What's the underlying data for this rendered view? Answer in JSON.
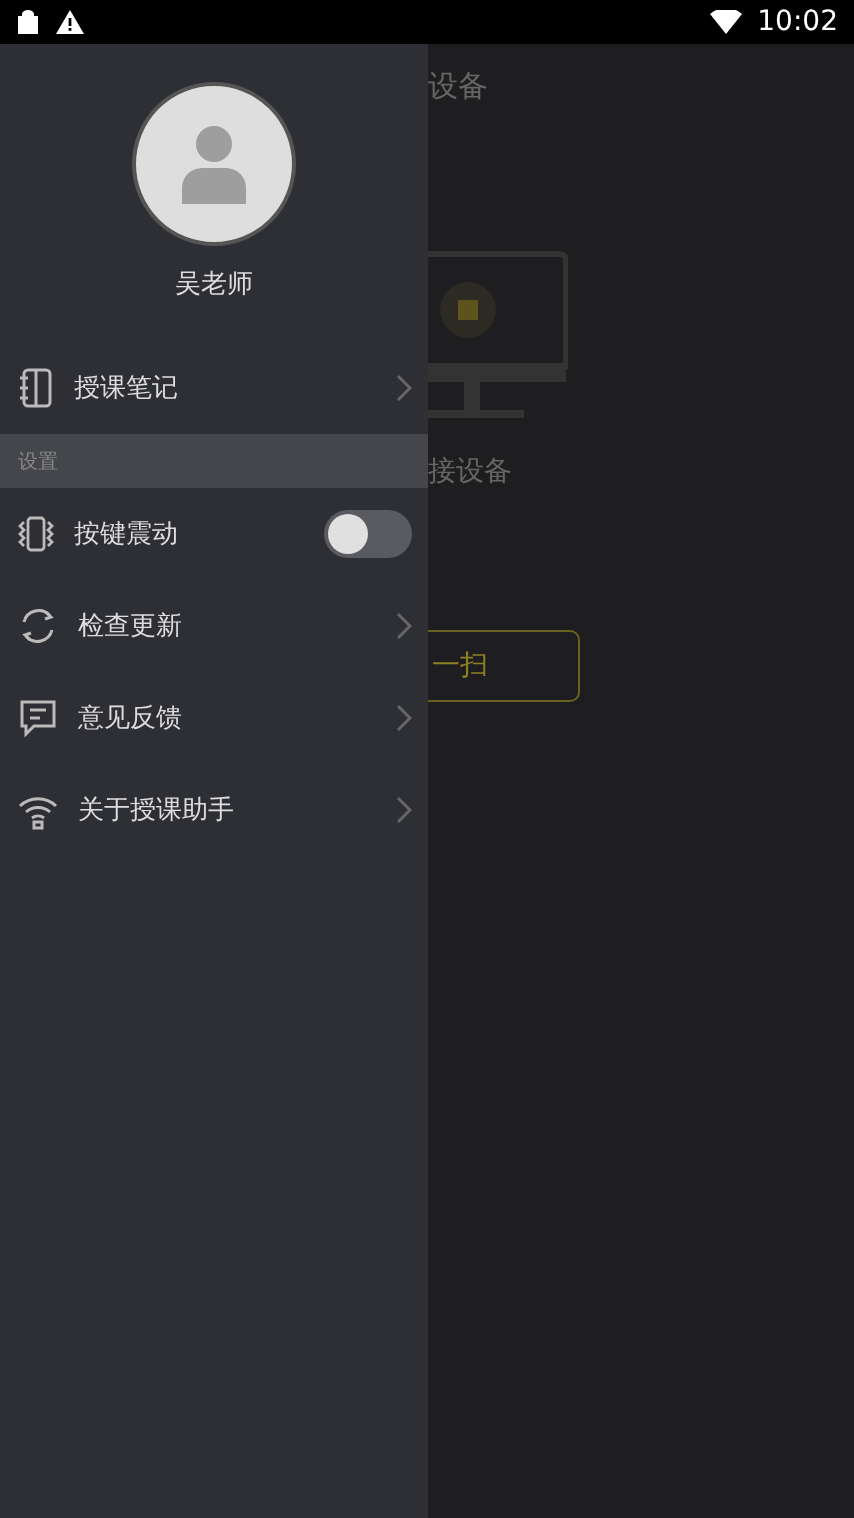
{
  "status_bar": {
    "time": "10:02"
  },
  "background_page": {
    "title": "设备",
    "empty_text": "接设备",
    "scan_button": "一扫"
  },
  "drawer": {
    "user_name": "吴老师",
    "items": [
      {
        "kind": "link",
        "label": "授课笔记"
      },
      {
        "kind": "section",
        "label": "设置"
      },
      {
        "kind": "toggle",
        "label": "按键震动",
        "on": false
      },
      {
        "kind": "link",
        "label": "检查更新"
      },
      {
        "kind": "link",
        "label": "意见反馈"
      },
      {
        "kind": "link",
        "label": "关于授课助手"
      }
    ]
  }
}
